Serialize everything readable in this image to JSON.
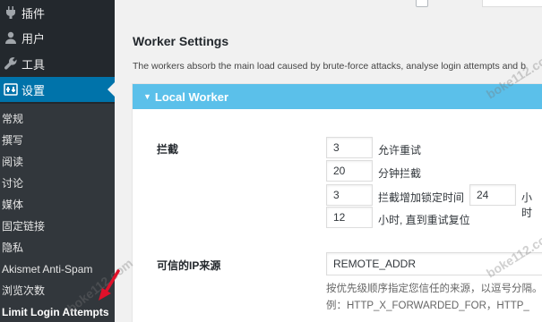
{
  "sidebar": {
    "menu": [
      {
        "label": "插件",
        "icon": "plugins-icon"
      },
      {
        "label": "用户",
        "icon": "users-icon"
      },
      {
        "label": "工具",
        "icon": "tools-icon"
      },
      {
        "label": "设置",
        "icon": "settings-icon",
        "active": true
      }
    ],
    "submenu": [
      "常规",
      "撰写",
      "阅读",
      "讨论",
      "媒体",
      "固定链接",
      "隐私",
      "Akismet Anti-Spam",
      "浏览次数",
      "Limit Login Attempts"
    ]
  },
  "main": {
    "section_title": "Worker Settings",
    "section_desc": "The workers absorb the main load caused by brute-force attacks, analyse login attempts and b",
    "panel_title": "Local Worker",
    "lockout": {
      "label": "拦截",
      "retries_value": "3",
      "retries_unit": "允许重试",
      "minutes_value": "20",
      "minutes_unit": "分钟拦截",
      "lockouts_value": "3",
      "lockouts_unit": "拦截增加锁定时间",
      "hours_value": "24",
      "hours_unit": "小时",
      "reset_value": "12",
      "reset_unit": "小时, 直到重试复位"
    },
    "trusted_ip": {
      "label": "可信的IP来源",
      "value": "REMOTE_ADDR",
      "help_line1": "按优先级顺序指定您信任的来源，以逗号分隔。",
      "help_line2": "例：HTTP_X_FORWARDED_FOR，HTTP_"
    }
  },
  "watermark": "boke112.com",
  "colors": {
    "sidebar": "#23282d",
    "submenu": "#32373c",
    "active": "#0073aa",
    "panel_header": "#5bc0ea",
    "arrow": "#e0102a"
  }
}
